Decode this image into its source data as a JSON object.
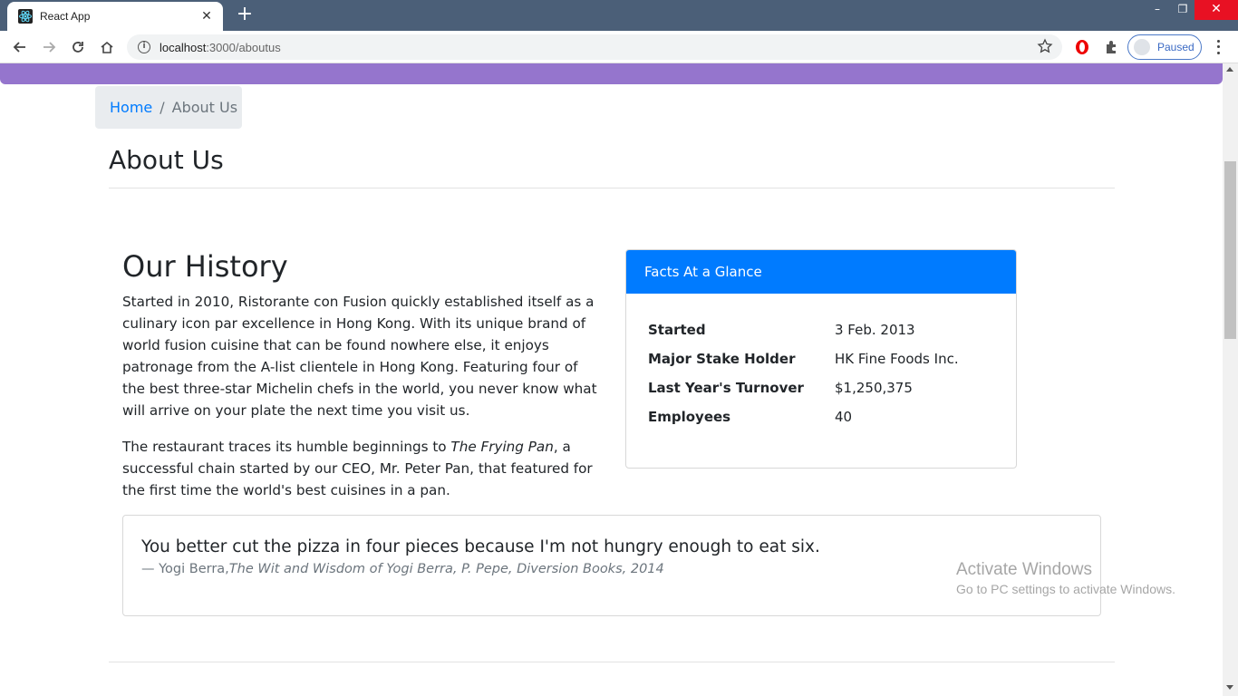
{
  "browser": {
    "tab_title": "React App",
    "tab_close": "✕",
    "new_tab": "+",
    "url_host": "localhost",
    "url_path": ":3000/aboutus",
    "profile_status": "Paused",
    "window_controls": {
      "minimize": "–",
      "maximize": "❐",
      "close": "✕"
    }
  },
  "page": {
    "accent_color": "#9575cd",
    "breadcrumb": {
      "home": "Home",
      "separator": "/",
      "current": "About Us"
    },
    "title": "About Us",
    "history": {
      "heading": "Our History",
      "p1": "Started in 2010, Ristorante con Fusion quickly established itself as a culinary icon par excellence in Hong Kong. With its unique brand of world fusion cuisine that can be found nowhere else, it enjoys patronage from the A-list clientele in Hong Kong. Featuring four of the best three-star Michelin chefs in the world, you never know what will arrive on your plate the next time you visit us.",
      "p2_before": "The restaurant traces its humble beginnings to ",
      "p2_em": "The Frying Pan",
      "p2_after": ", a successful chain started by our CEO, Mr. Peter Pan, that featured for the first time the world's best cuisines in a pan."
    },
    "facts": {
      "header": "Facts At a Glance",
      "header_color": "#007bff",
      "rows": [
        {
          "label": "Started",
          "value": "3 Feb. 2013"
        },
        {
          "label": "Major Stake Holder",
          "value": "HK Fine Foods Inc."
        },
        {
          "label": "Last Year's Turnover",
          "value": "$1,250,375"
        },
        {
          "label": "Employees",
          "value": "40"
        }
      ]
    },
    "quote": {
      "text": "You better cut the pizza in four pieces because I'm not hungry enough to eat six.",
      "author": "— Yogi Berra,",
      "source": "The Wit and Wisdom of Yogi Berra, P. Pepe, Diversion Books, 2014"
    }
  },
  "os_watermark": {
    "line1": "Activate Windows",
    "line2": "Go to PC settings to activate Windows."
  }
}
